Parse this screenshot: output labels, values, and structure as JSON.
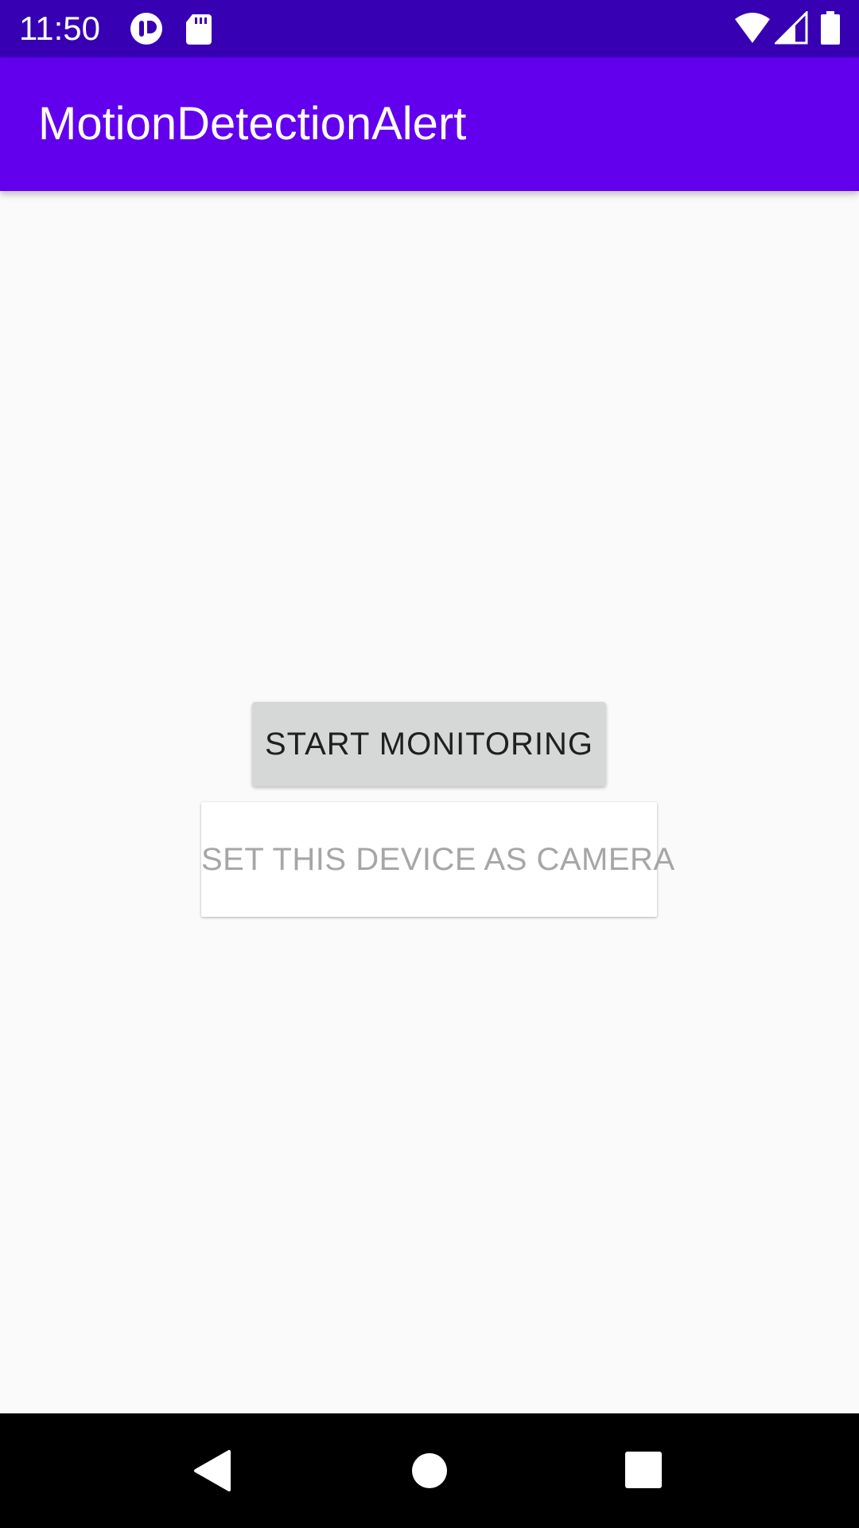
{
  "status_bar": {
    "time": "11:50",
    "left_icons": [
      "app-notification-icon",
      "sd-card-icon"
    ],
    "right_icons": [
      "wifi-icon",
      "cell-signal-icon",
      "battery-icon"
    ]
  },
  "app_bar": {
    "title": "MotionDetectionAlert"
  },
  "main": {
    "start_monitoring_label": "START MONITORING",
    "set_camera_label": "SET THIS DEVICE AS CAMERA"
  },
  "nav_bar": {
    "buttons": [
      "back-icon",
      "home-icon",
      "recents-icon"
    ]
  },
  "colors": {
    "status_bar": "#3700b3",
    "app_bar": "#6200ee",
    "background": "#fafafa",
    "nav_bar": "#000000"
  }
}
